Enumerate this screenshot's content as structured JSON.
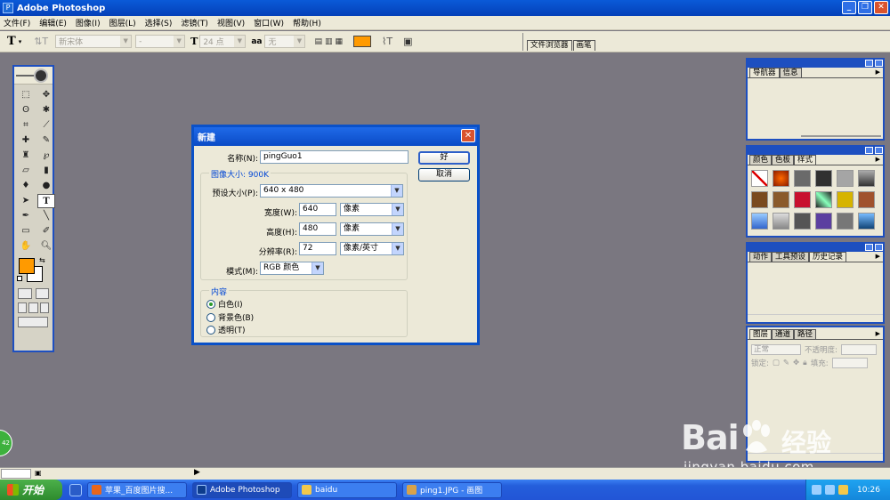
{
  "window": {
    "title": "Adobe Photoshop",
    "controls": [
      "_",
      "❐",
      "✕"
    ]
  },
  "menu": [
    "文件(F)",
    "编辑(E)",
    "图像(I)",
    "图层(L)",
    "选择(S)",
    "滤镜(T)",
    "视图(V)",
    "窗口(W)",
    "帮助(H)"
  ],
  "options": {
    "font_family": "新宋体",
    "font_style": "-",
    "font_size": "24 点",
    "aa_label": "aa",
    "antialias": "无",
    "text_color": "#ff9a00"
  },
  "palette_well": [
    "文件浏览器",
    "画笔"
  ],
  "toolbox": {
    "foreground": "#ff9a00",
    "background": "#ffffff"
  },
  "dialog": {
    "title": "新建",
    "name_label": "名称(N):",
    "name_value": "pingGuo1",
    "ok_label": "好",
    "cancel_label": "取消",
    "image_size_label": "图像大小: 900K",
    "preset_label": "预设大小(P):",
    "preset_value": "640 x 480",
    "width_label": "宽度(W):",
    "width_value": "640",
    "width_unit": "像素",
    "height_label": "高度(H):",
    "height_value": "480",
    "height_unit": "像素",
    "resolution_label": "分辨率(R):",
    "resolution_value": "72",
    "resolution_unit": "像素/英寸",
    "mode_label": "模式(M):",
    "mode_value": "RGB 颜色",
    "contents_label": "内容",
    "contents": [
      {
        "label": "白色(I)",
        "selected": true
      },
      {
        "label": "背景色(B)",
        "selected": false
      },
      {
        "label": "透明(T)",
        "selected": false
      }
    ]
  },
  "palettes": {
    "navigator_tabs": [
      "导航器",
      "信息"
    ],
    "color_tabs": [
      "颜色",
      "色板",
      "样式"
    ],
    "history_tabs": [
      "动作",
      "工具预设",
      "历史记录"
    ],
    "layers_tabs": [
      "图层",
      "通道",
      "路径"
    ],
    "blend_mode": "正常",
    "opacity_label": "不透明度:",
    "lock_label": "锁定:",
    "fill_label": "填充:"
  },
  "taskbar": {
    "start_label": "开始",
    "tasks": [
      "苹果_百度图片搜...",
      "Adobe Photoshop",
      "baidu",
      "ping1.JPG - 画图"
    ],
    "clock": "10:26"
  },
  "badge": "42",
  "watermark": {
    "brand": "Bai",
    "brand_tail": "经验",
    "url": "jingyan.baidu.com"
  }
}
